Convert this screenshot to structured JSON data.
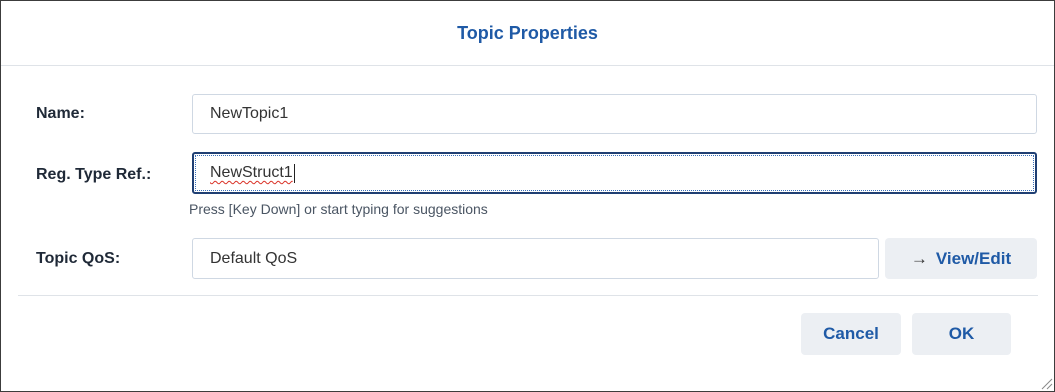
{
  "dialog": {
    "title": "Topic Properties"
  },
  "form": {
    "name": {
      "label": "Name:",
      "value": "NewTopic1"
    },
    "reg_type_ref": {
      "label": "Reg. Type Ref.:",
      "value": "NewStruct1",
      "hint": "Press [Key Down] or start typing for suggestions"
    },
    "topic_qos": {
      "label": "Topic QoS:",
      "value": "Default QoS",
      "view_edit_label": "View/Edit",
      "view_edit_icon": "arrow-right-icon"
    }
  },
  "buttons": {
    "cancel_label": "Cancel",
    "ok_label": "OK"
  },
  "colors": {
    "accent": "#1f5aa6",
    "focus_border": "#1f3f73",
    "button_bg": "#eceff3"
  }
}
